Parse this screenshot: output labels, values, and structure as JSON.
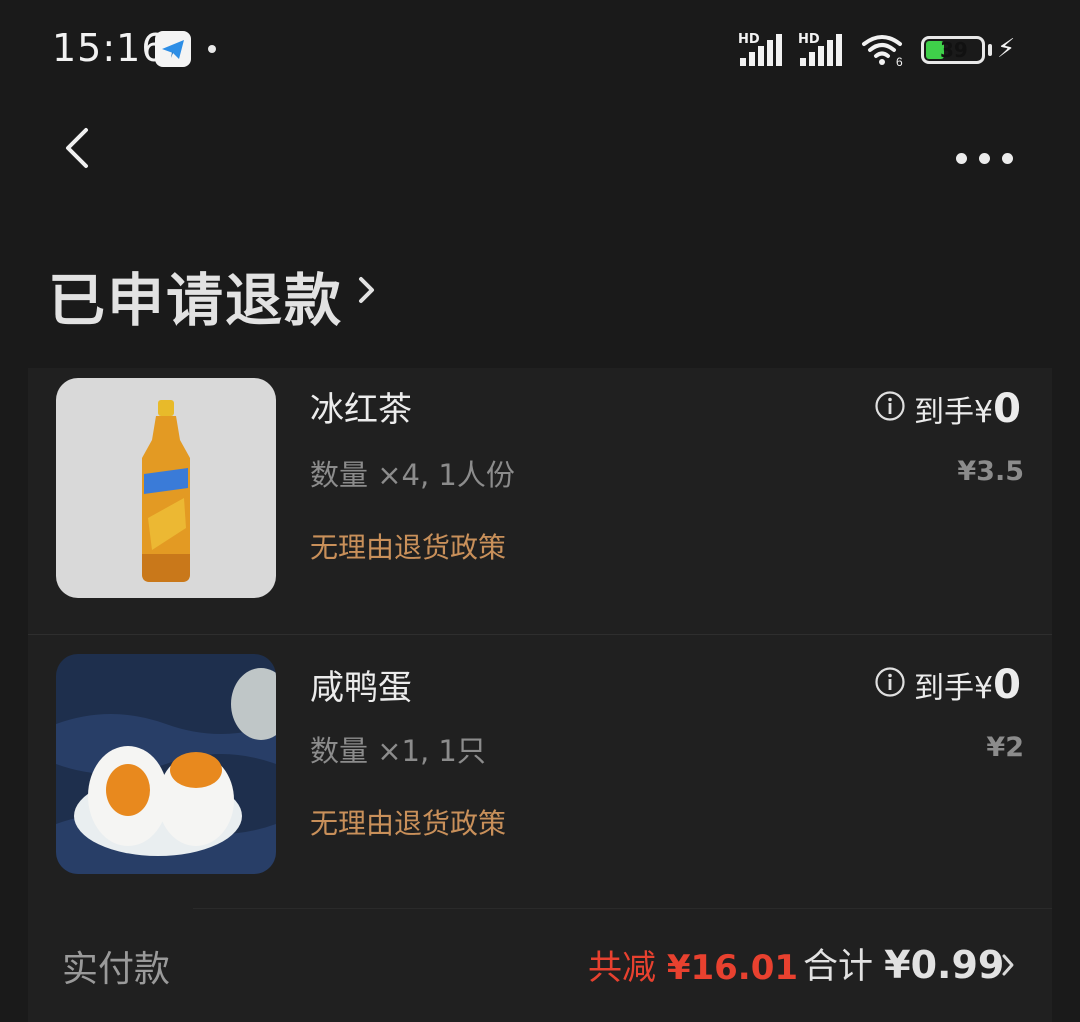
{
  "status_bar": {
    "time": "15:16",
    "battery_level": "39",
    "hd_label": "HD",
    "wifi_label": "6"
  },
  "header": {
    "title": "已申请退款"
  },
  "products": [
    {
      "name": "冰红茶",
      "quantity": "数量 ×4, 1人份",
      "policy": "无理由退货政策",
      "net_label": "到手¥",
      "net_value": "0",
      "original_price": "¥3.5",
      "image_icon": "iced-tea-bottle-image"
    },
    {
      "name": "咸鸭蛋",
      "quantity": "数量 ×1, 1只",
      "policy": "无理由退货政策",
      "net_label": "到手¥",
      "net_value": "0",
      "original_price": "¥2",
      "image_icon": "salted-duck-egg-image"
    }
  ],
  "footer": {
    "label": "实付款",
    "discount_label": "共减 ",
    "discount_value": "¥16.01",
    "total_label": "合计 ",
    "total_value": "¥0.99"
  },
  "colors": {
    "background": "#1a1a1a",
    "card": "#202020",
    "policy": "#c9905a",
    "discount": "#e8412f",
    "battery": "#3fcf4a"
  }
}
